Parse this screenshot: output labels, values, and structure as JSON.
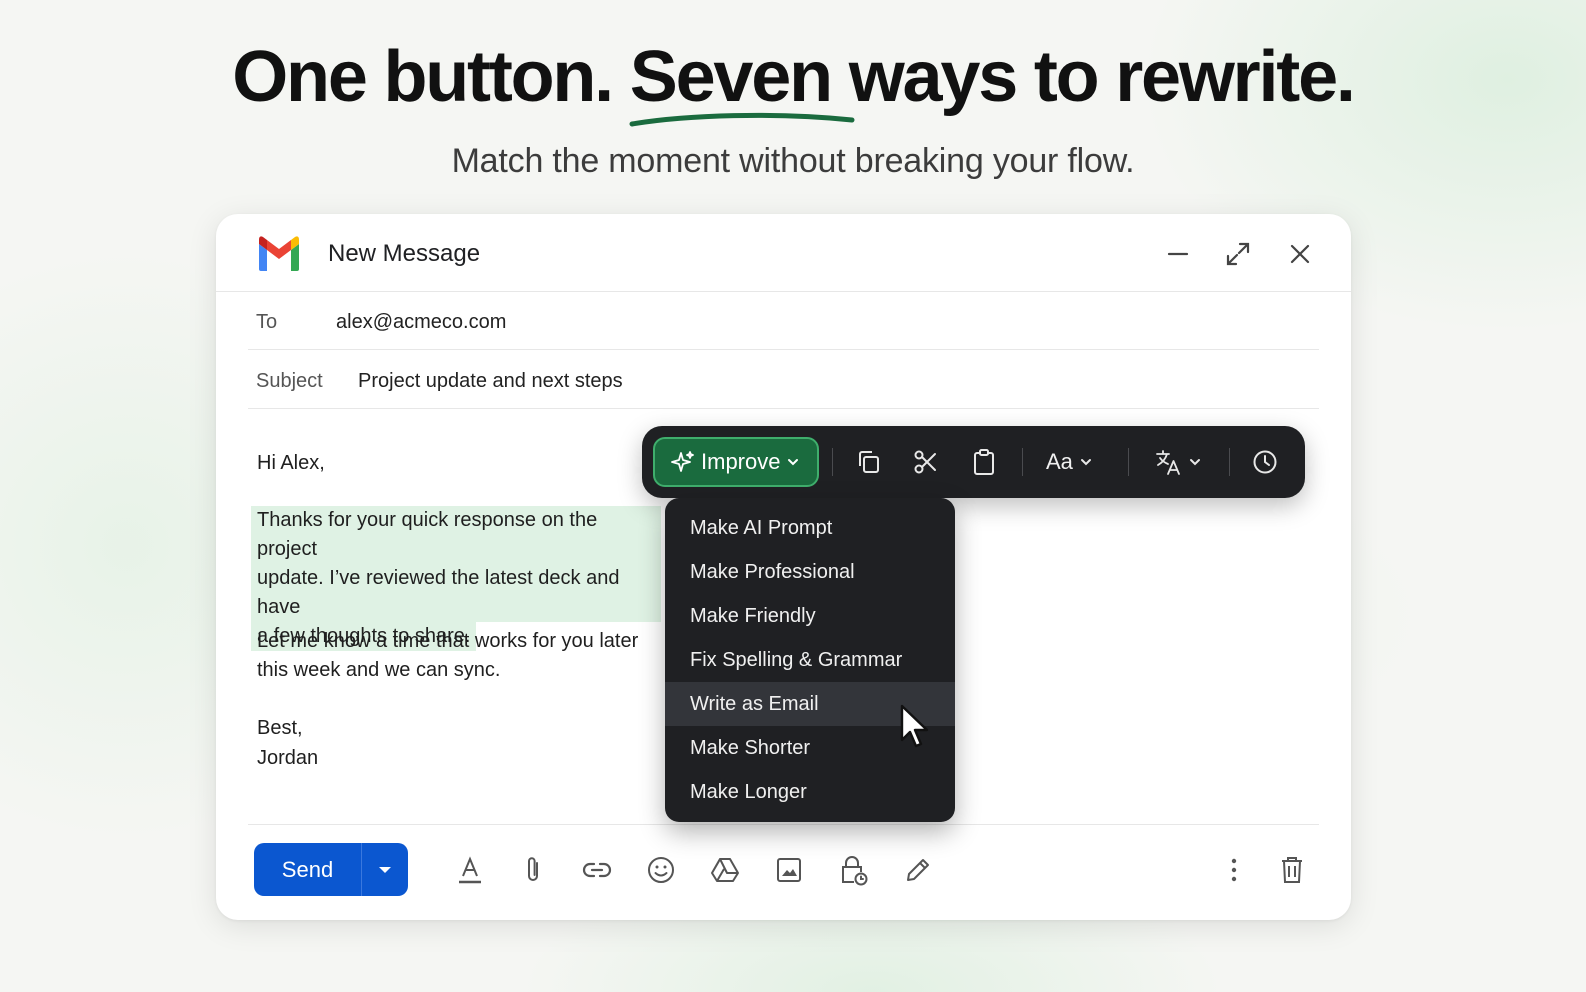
{
  "hero": {
    "headline_part1": "One button. ",
    "headline_highlight": "Seven",
    "headline_part2": " ways to rewrite.",
    "subtitle": "Match the moment without breaking your flow.",
    "accent_color": "#1a6b3e"
  },
  "compose": {
    "title": "New Message",
    "to_label": "To",
    "to_value": "alex@acmeco.com",
    "subject_label": "Subject",
    "subject_value": "Project update and next steps",
    "body": {
      "greeting": "Hi Alex,",
      "highlighted_lines": [
        "Thanks for your quick response on the project",
        "update. I’ve reviewed the latest deck and have",
        "a few thoughts to share."
      ],
      "para2_lines": [
        "Let me know a time that works for you later",
        "this week and we can sync."
      ],
      "signoff": "Best,",
      "signature": "Jordan"
    },
    "send_label": "Send",
    "send_color": "#0b57d0"
  },
  "toolbar": {
    "improve_label": "Improve",
    "font_label": "Aa",
    "icons": [
      "sparkle-icon",
      "copy-icon",
      "scissors-icon",
      "clipboard-icon",
      "translate-icon",
      "clock-icon"
    ]
  },
  "improve_menu": {
    "items": [
      "Make AI Prompt",
      "Make Professional",
      "Make Friendly",
      "Fix Spelling & Grammar",
      "Write as Email",
      "Make Shorter",
      "Make Longer"
    ],
    "hovered": "Write as Email"
  },
  "footer_icons": [
    "text-format-icon",
    "attach-icon",
    "link-icon",
    "emoji-icon",
    "drive-icon",
    "image-icon",
    "lock-clock-icon",
    "pen-icon",
    "more-vert-icon",
    "trash-icon"
  ]
}
